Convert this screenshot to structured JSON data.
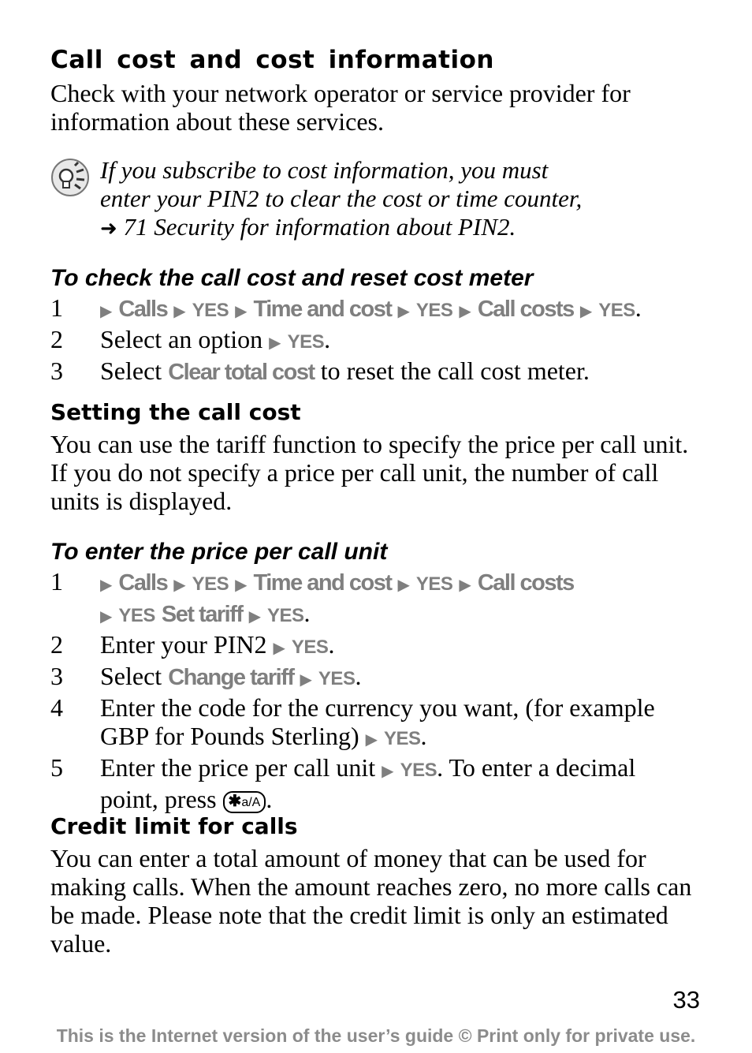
{
  "heading": "Call cost and cost information",
  "intro": "Check with your network operator or service provider for information about these services.",
  "note": {
    "icon": "lightbulb-tip-icon",
    "line1": "If you subscribe to cost information, you must",
    "line2": "enter your PIN2 to clear the cost or time counter,",
    "ref_arrow": "➜",
    "line3": "71 Security for information about PIN2."
  },
  "section1": {
    "title": "To check the call cost and reset cost meter",
    "steps": [
      {
        "num": "1",
        "menu": [
          "Calls",
          "YES",
          "Time and cost",
          "YES",
          "Call costs",
          "YES"
        ],
        "end": "."
      },
      {
        "num": "2",
        "text": "Select an option",
        "yes": "YES",
        "end": "."
      },
      {
        "num": "3",
        "pre": "Select",
        "kw": "Clear total cost",
        "post": "to reset the call cost meter."
      }
    ]
  },
  "section2": {
    "title": "Setting the call cost",
    "body": "You can use the tariff function to specify the price per call unit. If you do not specify a price per call unit, the number of call units is displayed."
  },
  "section3": {
    "title": "To enter the price per call unit",
    "steps": [
      {
        "num": "1",
        "menu_line1": [
          "Calls",
          "YES",
          "Time and cost",
          "YES",
          "Call costs"
        ],
        "menu_line2": [
          "YES",
          "Set tariff",
          "YES"
        ],
        "end": "."
      },
      {
        "num": "2",
        "text": "Enter your PIN2",
        "yes": "YES",
        "end": "."
      },
      {
        "num": "3",
        "pre": "Select",
        "kw": "Change tariff",
        "yes": "YES",
        "end": "."
      },
      {
        "num": "4",
        "line1": "Enter the code for the currency you want, (for example",
        "line2": "GBP for Pounds Sterling)",
        "yes": "YES",
        "end": "."
      },
      {
        "num": "5",
        "line1a": "Enter the price per call unit",
        "yes": "YES",
        "line1b": ". To enter a decimal",
        "line2": "point, press",
        "key_star": "✱",
        "key_label": "a/A",
        "end": "."
      }
    ]
  },
  "section4": {
    "title": "Credit limit for calls",
    "body": "You can enter a total amount of money that can be used for making calls. When the amount reaches zero, no more calls can be made. Please note that the credit limit is only an estimated value."
  },
  "arrow_glyph": "▶",
  "page_number": "33",
  "footer": "This is the Internet version of the user’s guide © Print only for private use."
}
